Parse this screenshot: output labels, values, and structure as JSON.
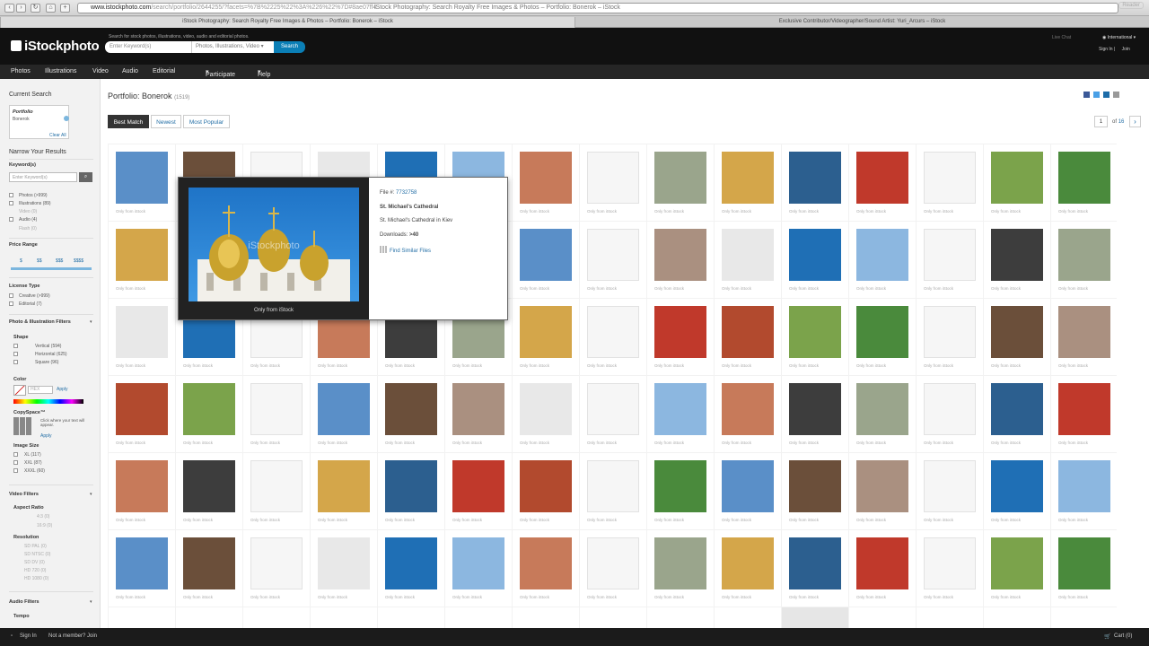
{
  "browser": {
    "url_host": "www.istockphoto.com",
    "url_rest": "/search/portfolio/2644255/?facets=%7B%2225%22%3A%226%22%7D#8ae07ff4",
    "url_title": "iStock Photography: Search Royalty Free Images & Photos – Portfolio: Bonerok – iStock",
    "reader": "Reader",
    "tabs": [
      {
        "label": "iStock Photography: Search Royalty Free Images & Photos – Portfolio: Bonerok – iStock"
      },
      {
        "label": "Exclusive Contributor/Videographer/Sound Artist: Yuri_Arcurs – iStock"
      }
    ]
  },
  "header": {
    "logo": "iStockphoto",
    "search_hint": "Search for stock photos, illustrations, video, audio and editorial photos.",
    "search_placeholder": "Enter Keyword(s)",
    "search_type": "Photos, Illustrations, Video",
    "search_button": "Search",
    "live_chat": "Live Chat",
    "international": "International",
    "sign_in": "Sign In",
    "join": "Join"
  },
  "nav": [
    "Photos",
    "Illustrations",
    "Video",
    "Audio",
    "Editorial",
    "Participate",
    "Help"
  ],
  "sidebar": {
    "current_search": "Current Search",
    "portfolio_label": "Portfolio",
    "portfolio_value": "Bonerok",
    "clear_all": "Clear All",
    "narrow": "Narrow Your Results",
    "keywords": "Keyword(s)",
    "kw_placeholder": "Enter Keyword(s)",
    "file_types": [
      {
        "label": "Photos",
        "count": "(>999)"
      },
      {
        "label": "Illustrations",
        "count": "(89)"
      },
      {
        "label": "Video",
        "count": "(0)"
      },
      {
        "label": "Audio",
        "count": "(4)"
      },
      {
        "label": "Flash",
        "count": "(0)"
      }
    ],
    "price_range": "Price Range",
    "prices": [
      "$",
      "$$",
      "$$$",
      "$$$$"
    ],
    "license_type": "License Type",
    "licenses": [
      {
        "label": "Creative",
        "count": "(>999)"
      },
      {
        "label": "Editorial",
        "count": "(7)"
      }
    ],
    "photo_filters": "Photo & Illustration Filters",
    "shape": "Shape",
    "shapes": [
      {
        "label": "Vertical",
        "count": "(594)"
      },
      {
        "label": "Horizontal",
        "count": "(625)"
      },
      {
        "label": "Square",
        "count": "(96)"
      }
    ],
    "color": "Color",
    "color_placeholder": "HEX",
    "apply": "Apply",
    "copyspace": "CopySpace™",
    "copyspace_hint": "Click where your text will appear.",
    "image_size": "Image Size",
    "sizes": [
      {
        "label": "XL",
        "count": "(117)"
      },
      {
        "label": "XXL",
        "count": "(87)"
      },
      {
        "label": "XXXL",
        "count": "(60)"
      }
    ],
    "video_filters": "Video Filters",
    "aspect_ratio": "Aspect Ratio",
    "aspects": [
      {
        "label": "4:3",
        "count": "(0)"
      },
      {
        "label": "16:9",
        "count": "(0)"
      }
    ],
    "resolution": "Resolution",
    "resolutions": [
      {
        "label": "SD PAL",
        "count": "(0)"
      },
      {
        "label": "SD NTSC",
        "count": "(0)"
      },
      {
        "label": "SD DV",
        "count": "(0)"
      },
      {
        "label": "HD 720",
        "count": "(0)"
      },
      {
        "label": "HD 1080",
        "count": "(0)"
      }
    ],
    "audio_filters": "Audio Filters",
    "tempo": "Tempo"
  },
  "main": {
    "title": "Portfolio: Bonerok",
    "count": "(1519)",
    "sort": [
      "Best Match",
      "Newest",
      "Most Popular"
    ],
    "page": "1",
    "of_label": "of",
    "total_pages": "16",
    "next": "›",
    "only_from": "Only from iStock"
  },
  "popup": {
    "file_label": "File #:",
    "file_no": "7732758",
    "title": "St. Michael's Cathedral",
    "desc": "St. Michael's Cathedral in Kiev",
    "downloads_label": "Downloads:",
    "downloads": ">40",
    "find_similar": "Find Similar Files",
    "caption": "Only from iStock",
    "watermark": "iStockphoto"
  },
  "bottom": {
    "sign_in": "Sign In",
    "not_member": "Not a member? Join",
    "cart": "Cart (0)"
  },
  "colors": {
    "header_bg": "#111111",
    "nav_bg": "#262626",
    "accent": "#0b7fb6",
    "link": "#246fa6"
  }
}
